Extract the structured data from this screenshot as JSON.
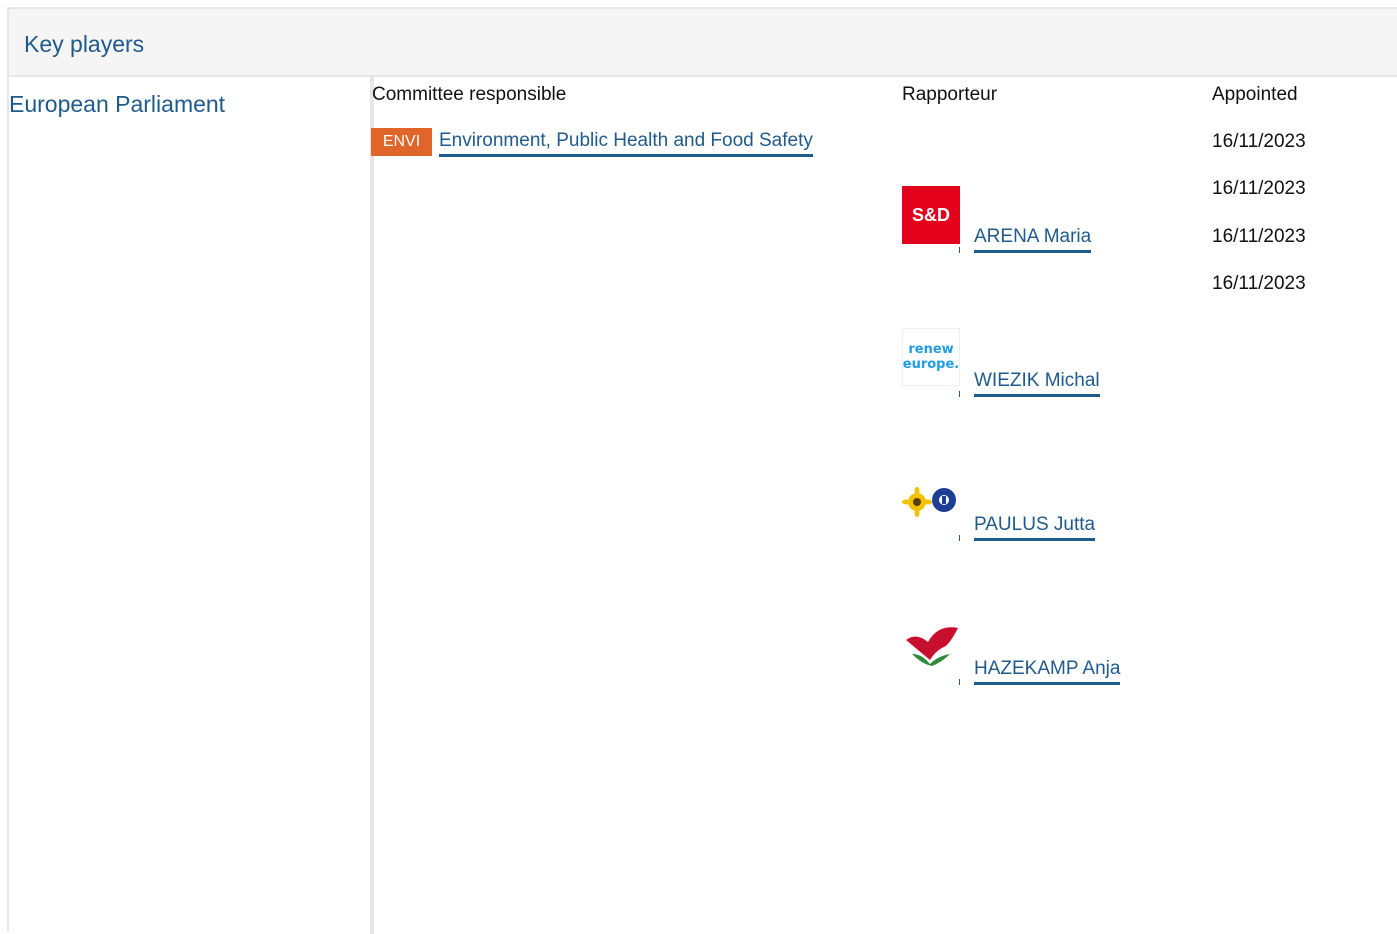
{
  "section": {
    "title": "Key players"
  },
  "institution": {
    "name": "European Parliament"
  },
  "columns": {
    "committee": "Committee responsible",
    "rapporteur": "Rapporteur",
    "appointed": "Appointed"
  },
  "committee": {
    "abbr": "ENVI",
    "name": "Environment, Public Health and Food Safety",
    "abbr_color": "#e0652b"
  },
  "dates": [
    "16/11/2023",
    "16/11/2023",
    "16/11/2023",
    "16/11/2023"
  ],
  "rapporteurs": [
    {
      "name": "ARENA Maria",
      "group_logo": "s-and-d-logo",
      "logo_text": "S&D"
    },
    {
      "name": "WIEZIK Michal",
      "group_logo": "renew-europe-logo",
      "logo_text_1": "renew",
      "logo_text_2": "europe."
    },
    {
      "name": "PAULUS Jutta",
      "group_logo": "greens-efa-logo"
    },
    {
      "name": "HAZEKAMP Anja",
      "group_logo": "gue-ngl-logo"
    }
  ],
  "colors": {
    "link": "#1f5a8c",
    "sd": "#e2001a",
    "renew": "#1f9de0"
  }
}
